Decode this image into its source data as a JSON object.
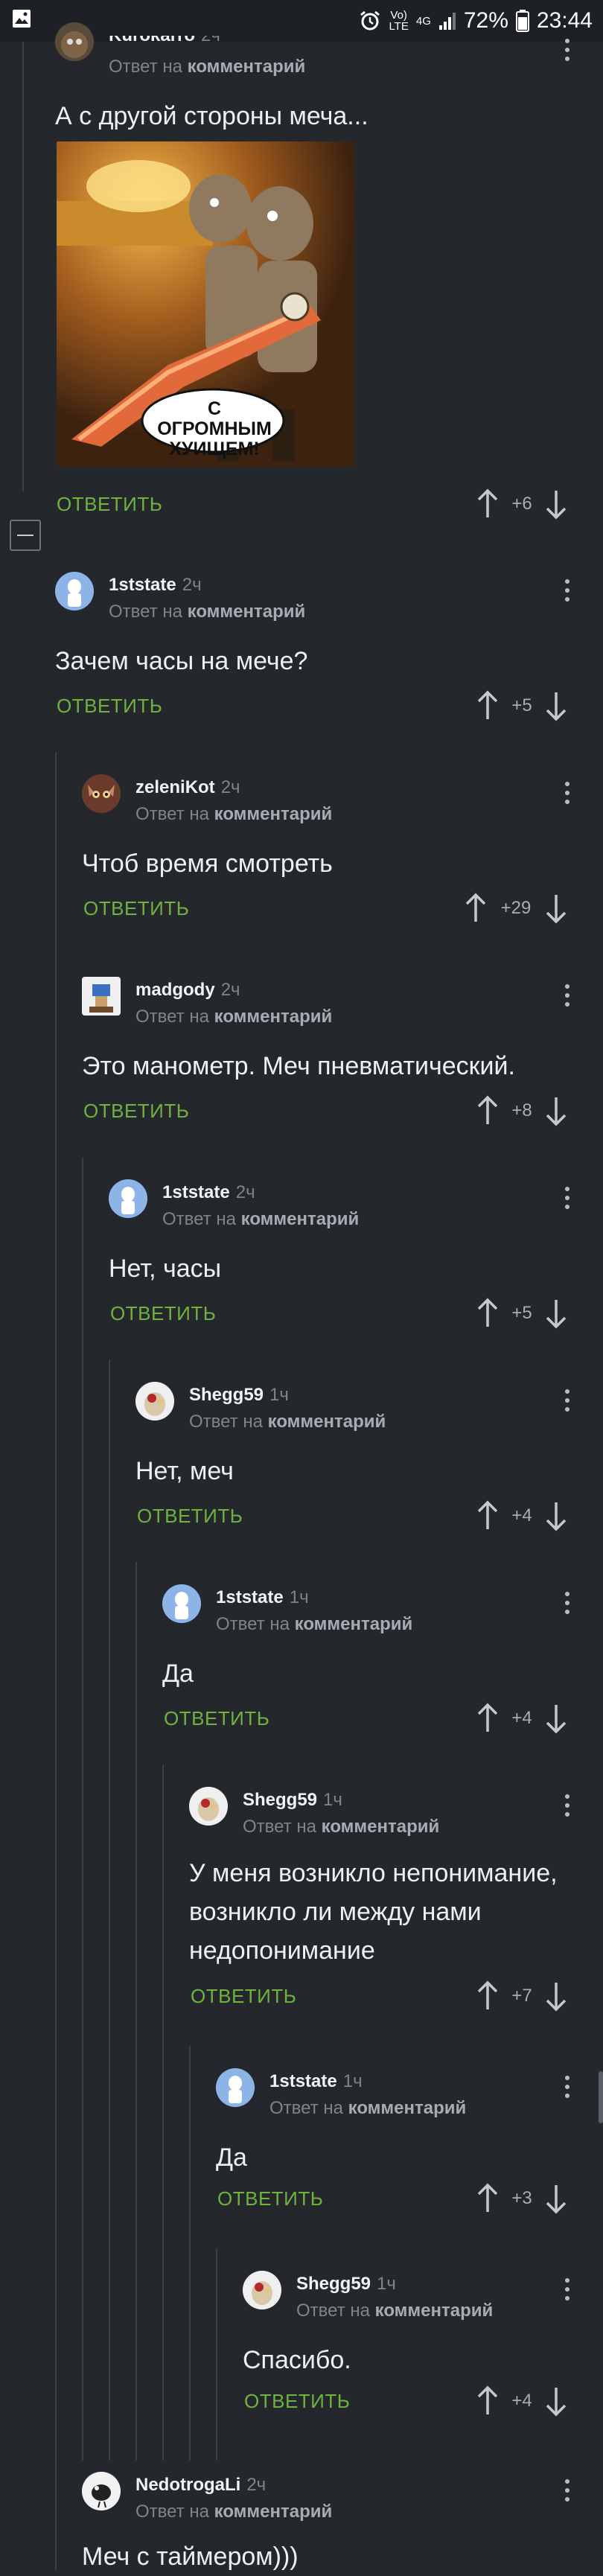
{
  "status_bar": {
    "signal_label": "Vo)\nLTE",
    "network": "4G",
    "battery": "72%",
    "time": "23:44"
  },
  "reply_prefix": "Ответ на",
  "reply_target": "комментарий",
  "reply_label": "ОТВЕТИТЬ",
  "meme_caption": "С ОГРОМНЫМ ХУИЩЕМ!",
  "comments": [
    {
      "user": "Kurokarro",
      "time": "2ч",
      "text": "А с другой стороны меча...",
      "score": "+6",
      "avatar": "brown-monster"
    },
    {
      "user": "1ststate",
      "time": "2ч",
      "text": "Зачем часы на мече?",
      "score": "+5",
      "avatar": "blue-figure"
    },
    {
      "user": "zeleniKot",
      "time": "2ч",
      "text": "Чтоб время смотреть",
      "score": "+29",
      "avatar": "cat"
    },
    {
      "user": "madgody",
      "time": "2ч",
      "text": "Это манометр. Меч пневматический.",
      "score": "+8",
      "avatar": "pixel"
    },
    {
      "user": "1ststate",
      "time": "2ч",
      "text": "Нет, часы",
      "score": "+5",
      "avatar": "blue-figure"
    },
    {
      "user": "Shegg59",
      "time": "1ч",
      "text": "Нет, меч",
      "score": "+4",
      "avatar": "bird"
    },
    {
      "user": "1ststate",
      "time": "1ч",
      "text": "Да",
      "score": "+4",
      "avatar": "blue-figure"
    },
    {
      "user": "Shegg59",
      "time": "1ч",
      "text": "У меня возникло непонимание, возникло ли между нами недопонимание",
      "score": "+7",
      "avatar": "bird"
    },
    {
      "user": "1ststate",
      "time": "1ч",
      "text": "Да",
      "score": "+3",
      "avatar": "blue-figure"
    },
    {
      "user": "Shegg59",
      "time": "1ч",
      "text": "Спасибо.",
      "score": "+4",
      "avatar": "bird"
    },
    {
      "user": "NedotrogaLi",
      "time": "2ч",
      "text": "Меч с таймером)))",
      "score": "",
      "avatar": "bw-bird"
    }
  ]
}
